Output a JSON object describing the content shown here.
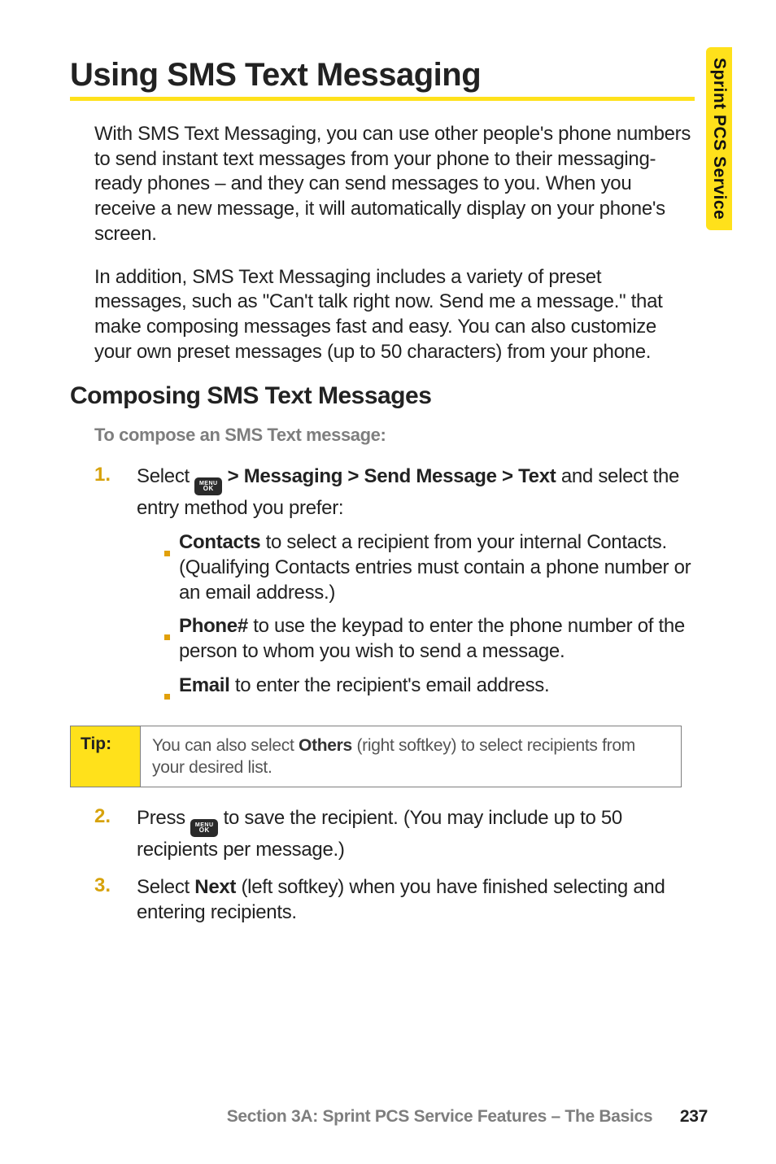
{
  "side_tab": "Sprint PCS Service",
  "title": "Using SMS Text Messaging",
  "intro_p1": "With SMS Text Messaging, you can use other people's phone numbers to send instant text messages from your phone to their messaging-ready phones – and they can send messages to you. When you receive a new message, it will automatically display on your phone's screen.",
  "intro_p2": "In addition, SMS Text Messaging includes a variety of preset messages, such as \"Can't talk right now. Send me a message.\" that make composing messages fast and easy. You can also customize your own preset messages (up to 50 characters) from your phone.",
  "section_heading": "Composing SMS Text Messages",
  "lead": "To compose an SMS Text message:",
  "menu_key": {
    "top": "MENU",
    "bottom": "OK"
  },
  "step1": {
    "num": "1.",
    "pre": "Select ",
    "path": " > Messaging > Send Message > Text",
    "post": " and select the entry method you prefer:"
  },
  "sub": {
    "contacts_label": "Contacts",
    "contacts_text": " to select a recipient from your internal Contacts. (Qualifying Contacts entries must contain a phone number or an email address.)",
    "phone_label": "Phone#",
    "phone_text": " to use the keypad to enter the phone number of the person to whom you wish to send a message.",
    "email_label": "Email",
    "email_text": " to enter the recipient's email address."
  },
  "tip": {
    "label": "Tip:",
    "pre": "You can also select ",
    "bold": "Others",
    "post": " (right softkey) to select recipients from your desired list."
  },
  "step2": {
    "num": "2.",
    "pre": "Press ",
    "post": " to save the recipient. (You may include up to 50 recipients per message.)"
  },
  "step3": {
    "num": "3.",
    "pre": "Select ",
    "bold": "Next",
    "post": " (left softkey) when you have finished selecting and entering recipients."
  },
  "footer": {
    "text": "Section 3A: Sprint PCS Service Features – The Basics",
    "page": "237"
  }
}
